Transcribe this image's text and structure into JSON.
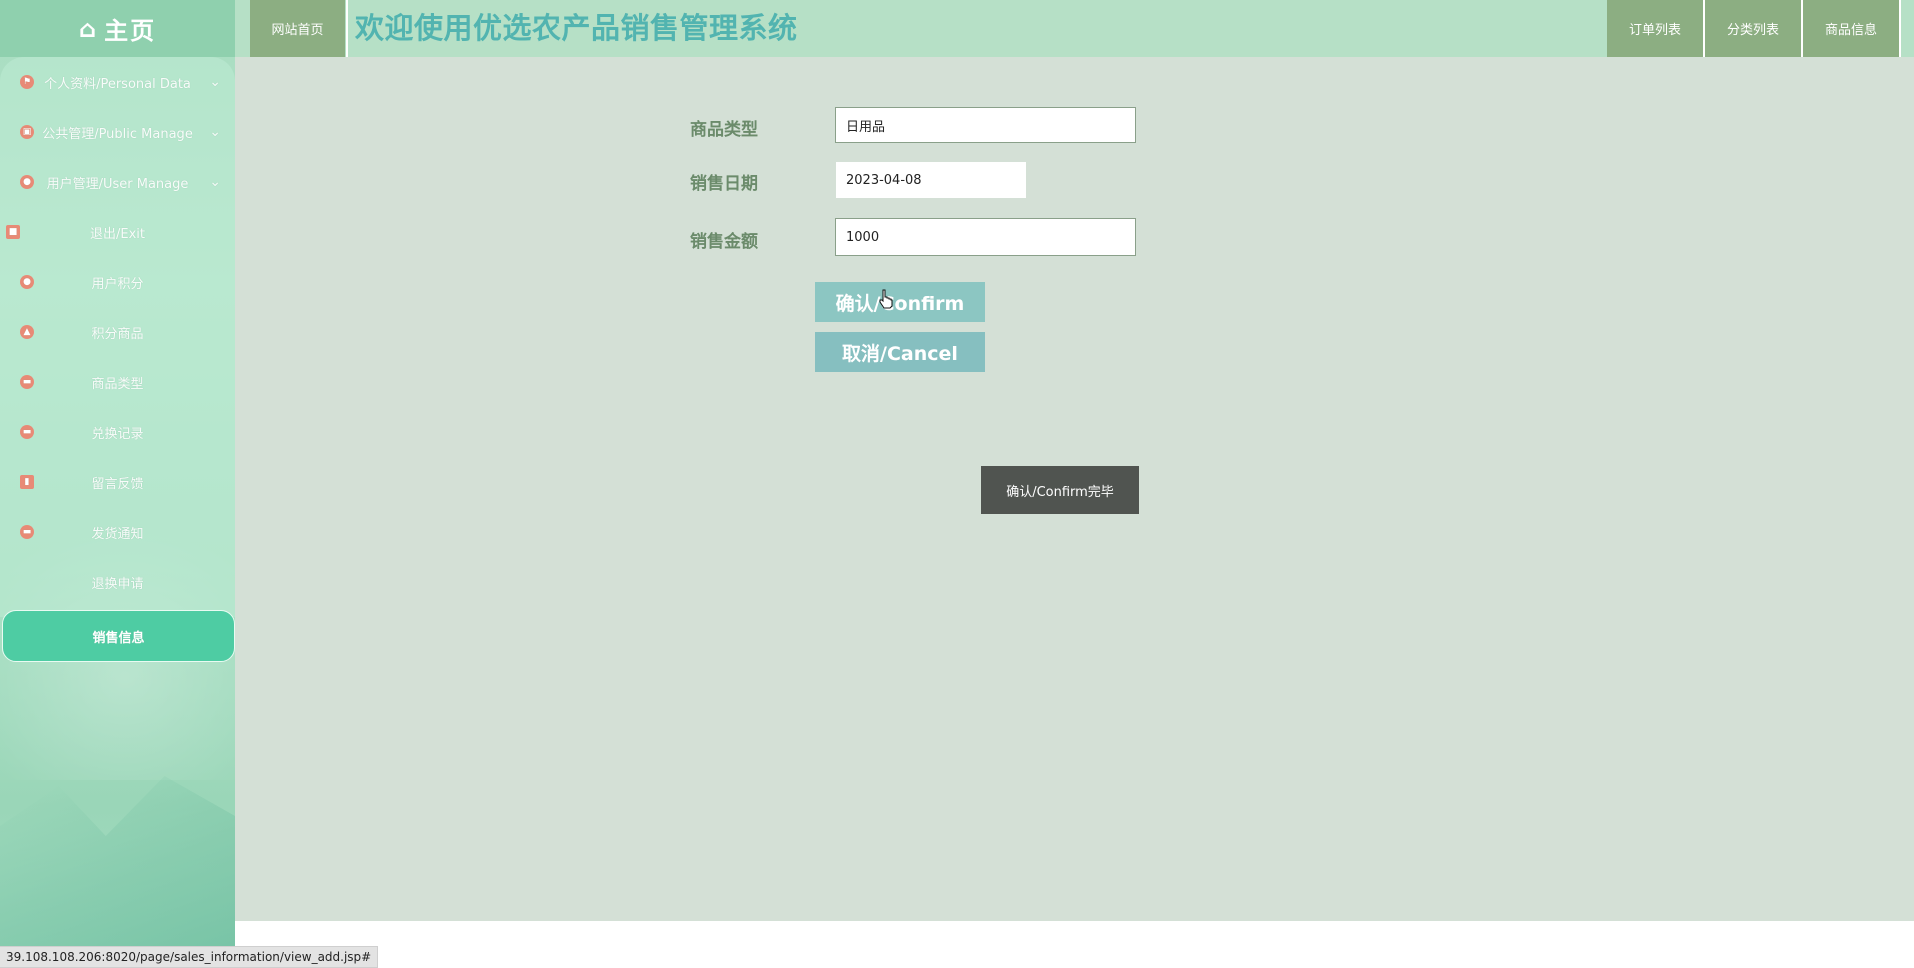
{
  "sidebar": {
    "brand": {
      "icon": "home-icon",
      "label": "主页"
    },
    "items": [
      {
        "label": "个人资料/Personal Data",
        "icon": "flag-icon",
        "expandable": true
      },
      {
        "label": "公共管理/Public Manage",
        "icon": "bus-icon",
        "expandable": true
      },
      {
        "label": "用户管理/User Manage",
        "icon": "user-icon",
        "expandable": true
      },
      {
        "label": "退出/Exit",
        "icon": "exit-icon",
        "expandable": false
      },
      {
        "label": "用户积分",
        "icon": "pin-icon",
        "expandable": false
      },
      {
        "label": "积分商品",
        "icon": "navigate-icon",
        "expandable": false
      },
      {
        "label": "商品类型",
        "icon": "chat-icon",
        "expandable": false
      },
      {
        "label": "兑换记录",
        "icon": "message-icon",
        "expandable": false
      },
      {
        "label": "留言反馈",
        "icon": "document-icon",
        "expandable": false
      },
      {
        "label": "发货通知",
        "icon": "mail-icon",
        "expandable": false
      },
      {
        "label": "退换申请",
        "icon": "",
        "expandable": false
      },
      {
        "label": "销售信息",
        "icon": "",
        "expandable": false,
        "active": true
      }
    ]
  },
  "header": {
    "home_link": "网站首页",
    "title": "欢迎使用优选农产品销售管理系统",
    "nav": [
      "订单列表",
      "分类列表",
      "商品信息"
    ]
  },
  "form": {
    "category": {
      "label": "商品类型",
      "value": "日用品"
    },
    "date": {
      "label": "销售日期",
      "value": "2023-04-08"
    },
    "amount": {
      "label": "销售金额",
      "value": "1000"
    },
    "confirm_label": "确认/Confirm",
    "cancel_label": "取消/Cancel",
    "done_label": "确认/Confirm完毕"
  },
  "status_bar": {
    "url": "39.108.108.206:8020/page/sales_information/view_add.jsp#"
  },
  "colors": {
    "sidebar_active": "#4ecca3",
    "header_bg": "#b6e0c6",
    "nav_btn": "#8cae82",
    "title_text": "#52b4b0",
    "main_bg": "#d4e0d6",
    "button_teal": "#8cc6c2",
    "button_dark": "#505450"
  }
}
